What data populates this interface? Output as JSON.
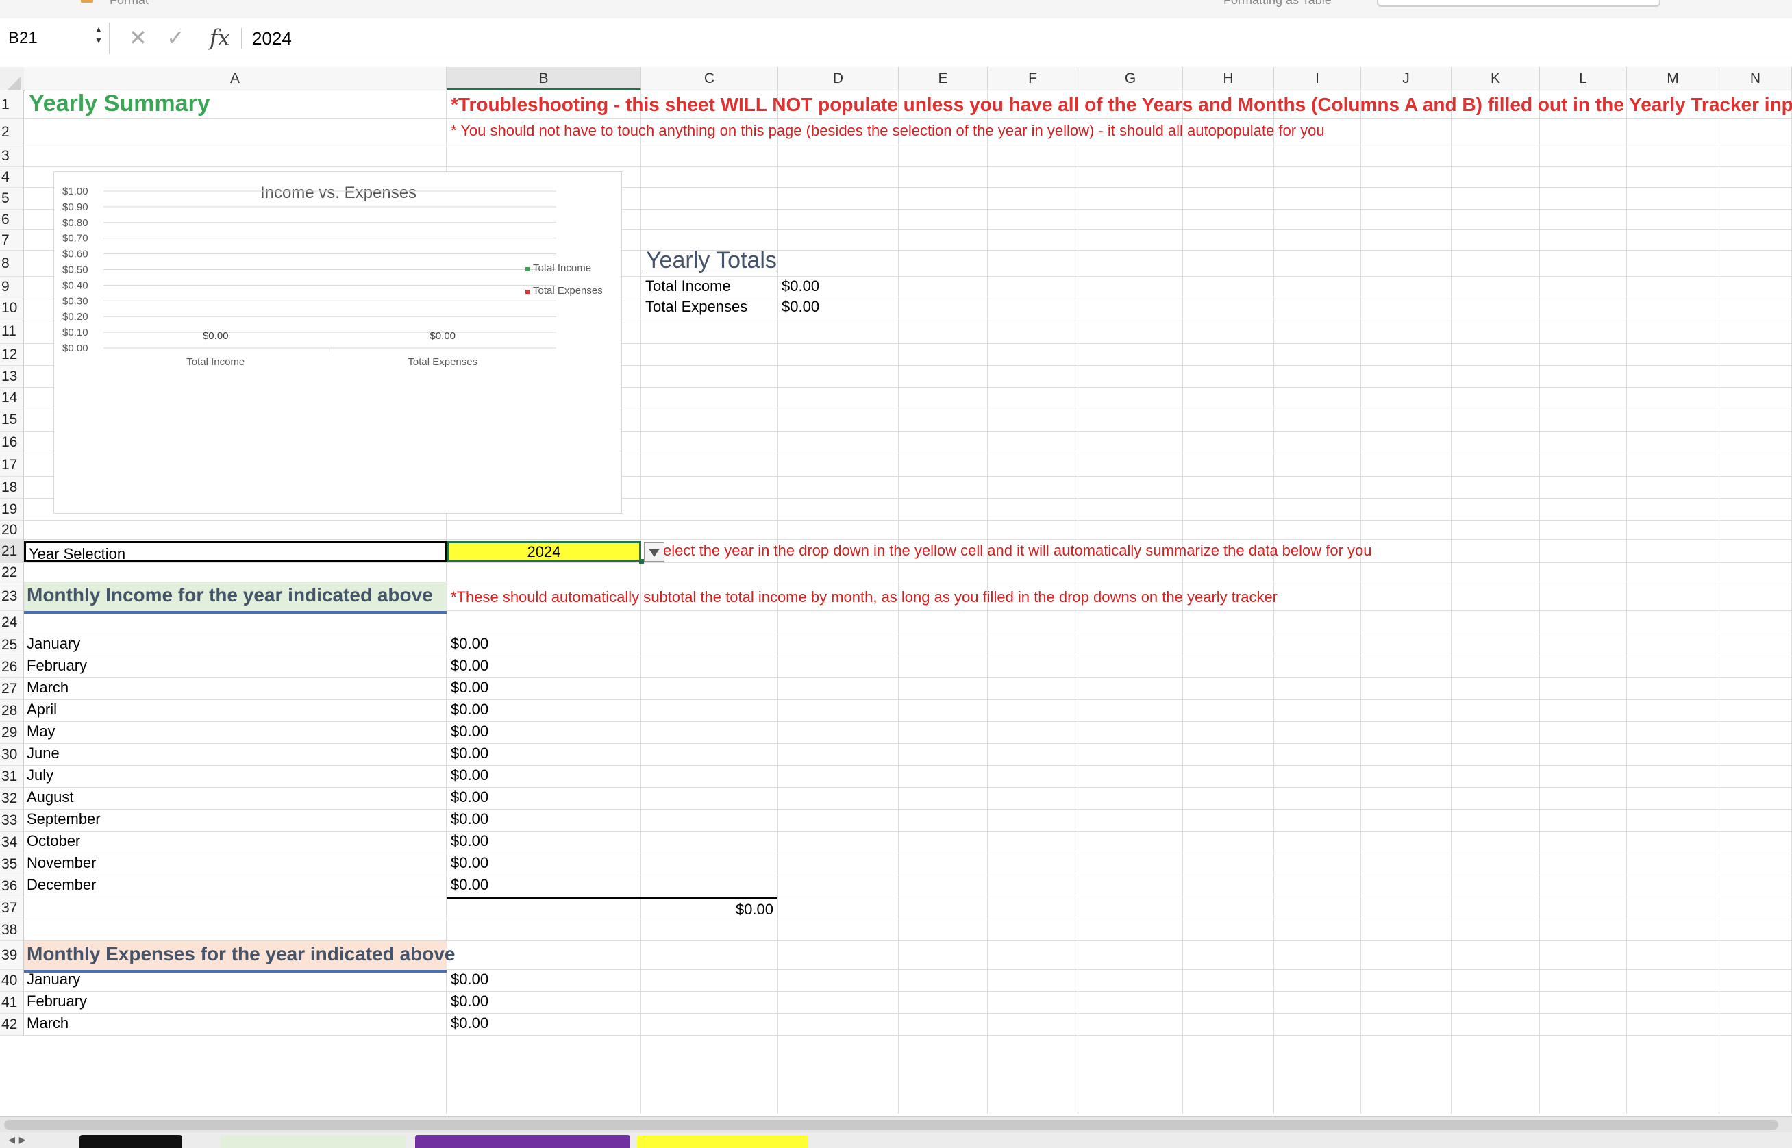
{
  "name_box": "B21",
  "formula_bar": {
    "cancel_icon": "✕",
    "enter_icon": "✓",
    "fx_label": "fx",
    "content": "2024"
  },
  "ribbon": {
    "fragment_left": "Format",
    "fragment_right": "Formatting   as Table"
  },
  "columns": [
    "A",
    "B",
    "C",
    "D",
    "E",
    "F",
    "G",
    "H",
    "I",
    "J",
    "K",
    "L",
    "M",
    "N"
  ],
  "rows": [
    "1",
    "2",
    "3",
    "4",
    "5",
    "6",
    "7",
    "8",
    "9",
    "10",
    "11",
    "12",
    "13",
    "14",
    "15",
    "16",
    "17",
    "18",
    "19",
    "20",
    "21",
    "22",
    "23",
    "24",
    "25",
    "26",
    "27",
    "28",
    "29",
    "30",
    "31",
    "32",
    "33",
    "34",
    "35",
    "36",
    "37",
    "38",
    "39",
    "40",
    "41",
    "42"
  ],
  "sheet": {
    "title": "Yearly Summary",
    "troubleshooting": "*Troubleshooting - this sheet WILL NOT populate unless you have all of the Years and Months (Columns A and B) filled out in the Yearly Tracker input Sheet",
    "note": "* You should not have to touch anything on this page (besides the selection of the year in yellow) - it should all autopopulate for you",
    "yearly_totals": {
      "header": "Yearly Totals",
      "income_label": "Total Income",
      "income_value": "$0.00",
      "expenses_label": "Total Expenses",
      "expenses_value": "$0.00"
    },
    "year_selection": {
      "label": "Year Selection",
      "value": "2024",
      "instruction": "elect the year in the drop down in the yellow cell and it will automatically summarize the data below for you"
    },
    "income_section": {
      "header": "Monthly Income for the year indicated above",
      "note": "*These should automatically subtotal the total income by month, as long as you filled in the drop downs on the yearly tracker",
      "months": [
        {
          "name": "January",
          "value": "$0.00"
        },
        {
          "name": "February",
          "value": "$0.00"
        },
        {
          "name": "March",
          "value": "$0.00"
        },
        {
          "name": "April",
          "value": "$0.00"
        },
        {
          "name": "May",
          "value": "$0.00"
        },
        {
          "name": "June",
          "value": "$0.00"
        },
        {
          "name": "July",
          "value": "$0.00"
        },
        {
          "name": "August",
          "value": "$0.00"
        },
        {
          "name": "September",
          "value": "$0.00"
        },
        {
          "name": "October",
          "value": "$0.00"
        },
        {
          "name": "November",
          "value": "$0.00"
        },
        {
          "name": "December",
          "value": "$0.00"
        }
      ],
      "total": "$0.00"
    },
    "expense_section": {
      "header": "Monthly Expenses for the year indicated above",
      "months": [
        {
          "name": "January",
          "value": "$0.00"
        },
        {
          "name": "February",
          "value": "$0.00"
        },
        {
          "name": "March",
          "value": "$0.00"
        }
      ]
    }
  },
  "chart_data": {
    "type": "bar",
    "title": "Income vs. Expenses",
    "categories": [
      "Total Income",
      "Total Expenses"
    ],
    "series": [
      {
        "name": "Total Income",
        "values": [
          0,
          null
        ],
        "color": "#3aa655"
      },
      {
        "name": "Total Expenses",
        "values": [
          null,
          0
        ],
        "color": "#e03131"
      }
    ],
    "data_labels": [
      "$0.00",
      "$0.00"
    ],
    "y_ticks": [
      "$0.00",
      "$0.10",
      "$0.20",
      "$0.30",
      "$0.40",
      "$0.50",
      "$0.60",
      "$0.70",
      "$0.80",
      "$0.90",
      "$1.00"
    ],
    "ylim": [
      0,
      1
    ],
    "grid": true,
    "legend_position": "right"
  },
  "colors": {
    "title_green": "#3aa655",
    "warning_red": "#e03131",
    "selection_green": "#217346",
    "year_yellow": "#ffff33",
    "section_heading": "#44546a",
    "income_bg": "#e2efda",
    "expense_bg": "#fbe3d6"
  },
  "sheet_tabs": [
    {
      "color": "#111111"
    },
    {
      "color": "#e2efda"
    },
    {
      "color": "#7030a0"
    },
    {
      "color": "#ffff33"
    }
  ]
}
